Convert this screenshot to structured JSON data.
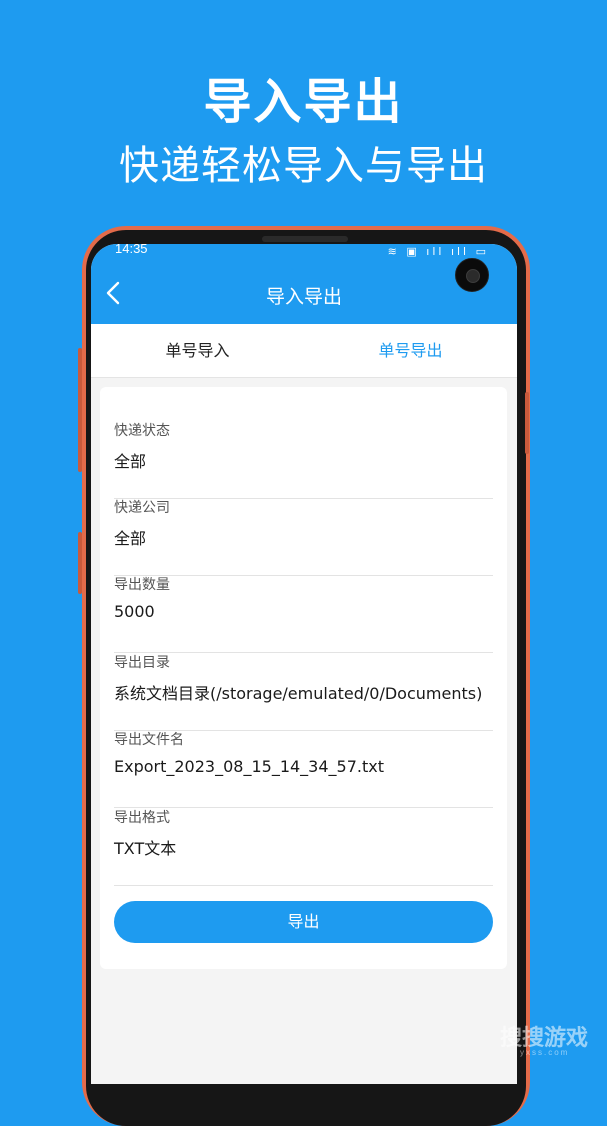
{
  "promo": {
    "title": "导入导出",
    "subtitle": "快递轻松导入与导出"
  },
  "status_bar": {
    "time": "14:35",
    "icons_text": "≋ ▣ ıll ıll ▭"
  },
  "nav": {
    "title": "导入导出",
    "back_icon": "chevron-left-icon"
  },
  "tabs": [
    {
      "label": "单号导入",
      "active": false
    },
    {
      "label": "单号导出",
      "active": true
    }
  ],
  "form": {
    "fields": [
      {
        "label": "快递状态",
        "value": "全部"
      },
      {
        "label": "快递公司",
        "value": "全部"
      },
      {
        "label": "导出数量",
        "value": "5000"
      },
      {
        "label": "导出目录",
        "value": "系统文档目录(/storage/emulated/0/Documents)"
      },
      {
        "label": "导出文件名",
        "value": "Export_2023_08_15_14_34_57.txt"
      },
      {
        "label": "导出格式",
        "value": "TXT文本"
      }
    ],
    "submit_label": "导出"
  },
  "watermark": {
    "text": "搜搜游戏",
    "sub": "yxss.com"
  },
  "colors": {
    "accent": "#1e9bf0",
    "phone_frame": "#e36b4a",
    "background": "#f4f4f4"
  }
}
